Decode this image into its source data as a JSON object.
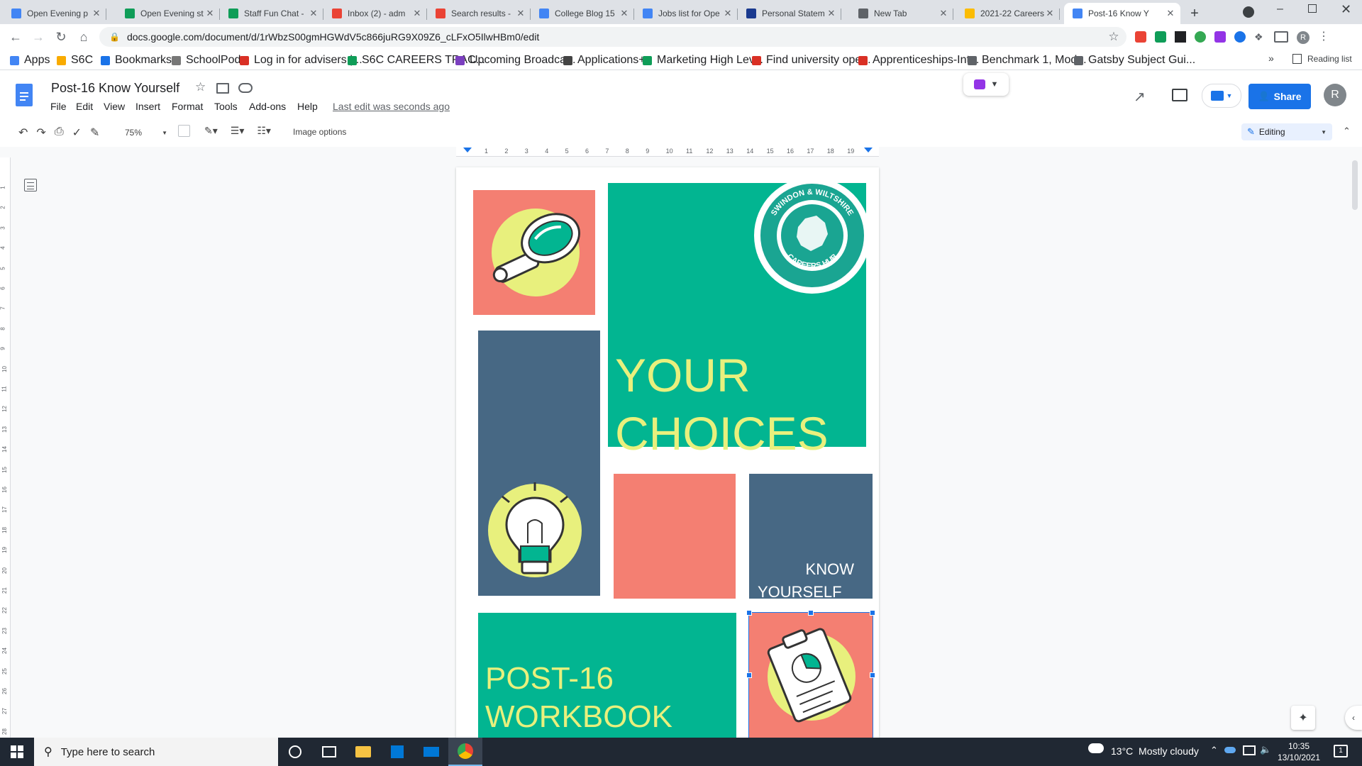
{
  "browser": {
    "tabs": [
      {
        "title": "Open Evening p",
        "color": "#4285f4"
      },
      {
        "title": "Open Evening st",
        "color": "#0f9d58"
      },
      {
        "title": "Staff Fun Chat -",
        "color": "#0f9d58"
      },
      {
        "title": "Inbox (2) - adm",
        "color": "#ea4335"
      },
      {
        "title": "Search results -",
        "color": "#ea4335"
      },
      {
        "title": "College Blog 15",
        "color": "#4285f4"
      },
      {
        "title": "Jobs list for Ope",
        "color": "#4285f4"
      },
      {
        "title": "Personal Statem",
        "color": "#1a3a8f"
      },
      {
        "title": "New Tab",
        "color": "#5f6368"
      },
      {
        "title": "2021-22 Careers",
        "color": "#fbbc04"
      },
      {
        "title": "Post-16 Know Y",
        "color": "#4285f4",
        "active": true
      }
    ],
    "new_tab": "+",
    "url": "docs.google.com/document/d/1rWbzS00gmHGWdV5c866juRG9X09Z6_cLFxO5IlwHBm0/edit",
    "bookmarks": [
      {
        "label": "Apps",
        "color": "#4285f4"
      },
      {
        "label": "S6C",
        "color": "#f9ab00"
      },
      {
        "label": "Bookmarks",
        "color": "#1a73e8"
      },
      {
        "label": "SchoolPod",
        "color": "#777777"
      },
      {
        "label": "Log in for advisers |...",
        "color": "#d93025"
      },
      {
        "label": "S6C CAREERS TRAC...",
        "color": "#0f9d58"
      },
      {
        "label": "Upcoming Broadca...",
        "color": "#7b3fbf"
      },
      {
        "label": "Applications+",
        "color": "#444444"
      },
      {
        "label": "Marketing High Lev...",
        "color": "#0f9d58"
      },
      {
        "label": "Find university ope...",
        "color": "#d93025"
      },
      {
        "label": "Apprenticeships-Int...",
        "color": "#d93025"
      },
      {
        "label": "Benchmark 1, Mod...",
        "color": "#5f6368"
      },
      {
        "label": "Gatsby Subject Gui...",
        "color": "#5f6368"
      }
    ],
    "bookmarks_more": "»",
    "reading_list": "Reading list"
  },
  "docs": {
    "title": "Post-16 Know Yourself",
    "menus": [
      "File",
      "Edit",
      "View",
      "Insert",
      "Format",
      "Tools",
      "Add-ons",
      "Help"
    ],
    "last_edit": "Last edit was seconds ago",
    "share_label": "Share",
    "avatar_letter": "R",
    "zoom": "75%",
    "image_options": "Image options",
    "mode": "Editing"
  },
  "ruler_ticks": [
    "1",
    "2",
    "3",
    "4",
    "5",
    "6",
    "7",
    "8",
    "9",
    "10",
    "11",
    "12",
    "13",
    "14",
    "15",
    "16",
    "17",
    "18",
    "19"
  ],
  "vruler_ticks": [
    "1",
    "2",
    "3",
    "4",
    "5",
    "6",
    "7",
    "8",
    "9",
    "10",
    "11",
    "12",
    "13",
    "14",
    "15",
    "16",
    "17",
    "18",
    "19",
    "20",
    "21",
    "22",
    "23",
    "24",
    "25",
    "26",
    "27",
    "28"
  ],
  "poster": {
    "badge_top": "SWINDON & WILTSHIRE",
    "badge_bottom": "CAREERS HUB",
    "heading_line1": "YOUR",
    "heading_line2": "CHOICES",
    "know_line1": "KNOW",
    "know_line2": "YOURSELF",
    "post_line1": "POST-16",
    "post_line2": "WORKBOOK",
    "colors": {
      "coral": "#f47f72",
      "green": "#02b591",
      "slate": "#476884",
      "yellow": "#e8f07d"
    }
  },
  "taskbar": {
    "search_placeholder": "Type here to search",
    "weather": "13°C  Mostly cloudy",
    "time": "10:35",
    "date": "13/10/2021",
    "notifications": "1"
  }
}
